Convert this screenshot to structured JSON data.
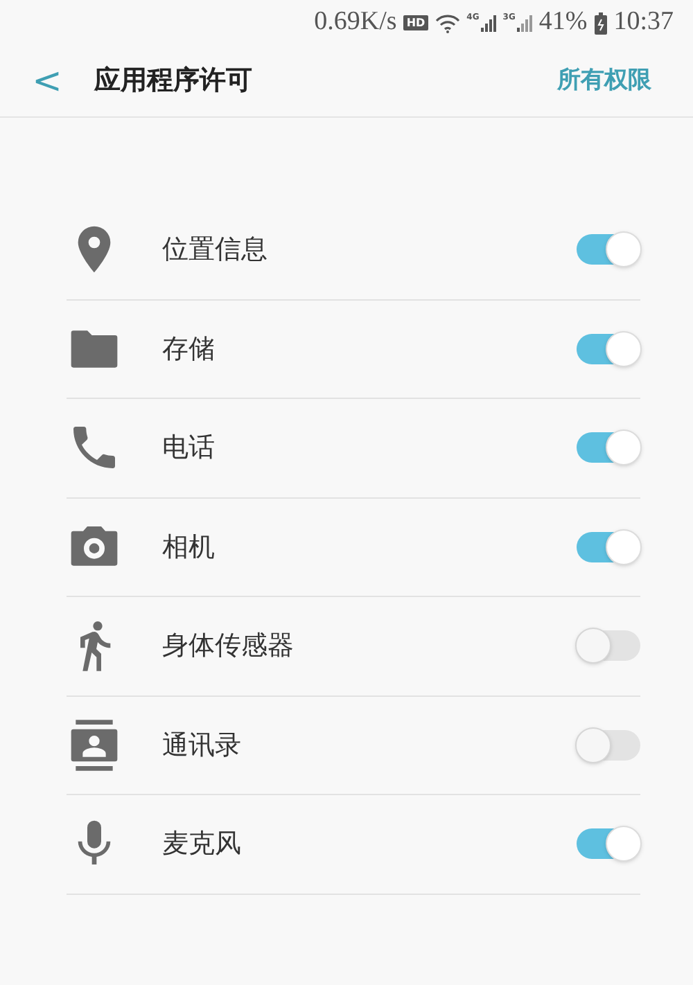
{
  "status_bar": {
    "speed": "0.69K/s",
    "hd": "HD",
    "net_1": "4G",
    "net_2": "3G",
    "battery": "41%",
    "time": "10:37"
  },
  "header": {
    "back": "<",
    "title": "应用程序许可",
    "action": "所有权限"
  },
  "permissions": [
    {
      "label": "位置信息",
      "on": true
    },
    {
      "label": "存储",
      "on": true
    },
    {
      "label": "电话",
      "on": true
    },
    {
      "label": "相机",
      "on": true
    },
    {
      "label": "身体传感器",
      "on": false
    },
    {
      "label": "通讯录",
      "on": false
    },
    {
      "label": "麦克风",
      "on": true
    }
  ]
}
